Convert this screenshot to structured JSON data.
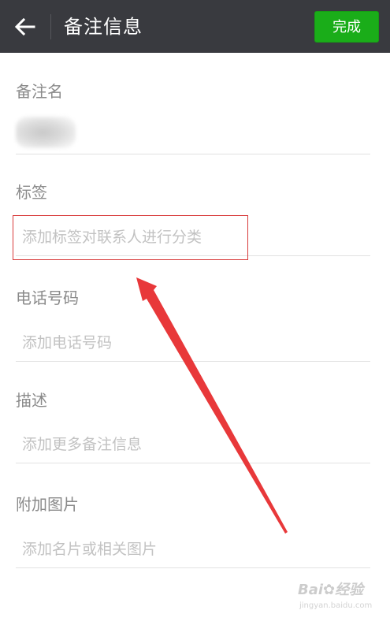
{
  "header": {
    "back_icon": "arrow-left-icon",
    "title": "备注信息",
    "done_label": "完成",
    "done_color": "#1aad19",
    "background_color": "#393a3f"
  },
  "sections": {
    "remark_name": {
      "label": "备注名",
      "value_blurred": true
    },
    "tags": {
      "label": "标签",
      "placeholder": "添加标签对联系人进行分类",
      "highlighted": true
    },
    "phone": {
      "label": "电话号码",
      "placeholder": "添加电话号码"
    },
    "description": {
      "label": "描述",
      "placeholder": "添加更多备注信息"
    },
    "attachment": {
      "label": "附加图片",
      "placeholder": "添加名片或相关图片"
    }
  },
  "annotation": {
    "highlight_color": "#d83b3b",
    "arrow_color": "#e8383a"
  },
  "watermark": {
    "logo": "Bai✿经验",
    "url": "jingyan.baidu.com"
  }
}
